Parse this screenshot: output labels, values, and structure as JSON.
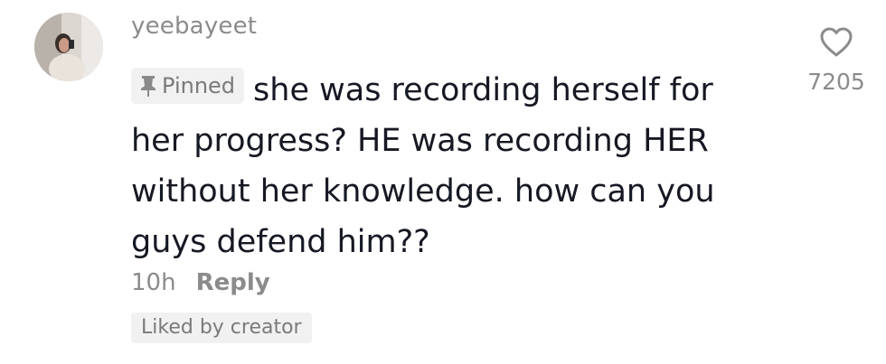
{
  "comment": {
    "username": "yeebayeet",
    "pinned_label": "Pinned",
    "text": "she was recording herself for her progress? HE was recording HER without her knowledge. how can you guys defend him??",
    "time": "10h",
    "reply_label": "Reply",
    "liked_by_creator_label": "Liked by creator",
    "like_count": "7205",
    "like_icon": "heart-outline-icon",
    "pin_icon": "pin-icon"
  },
  "colors": {
    "text_primary": "#161823",
    "text_secondary": "#8b8b8b",
    "badge_bg": "#f1f1f2"
  }
}
